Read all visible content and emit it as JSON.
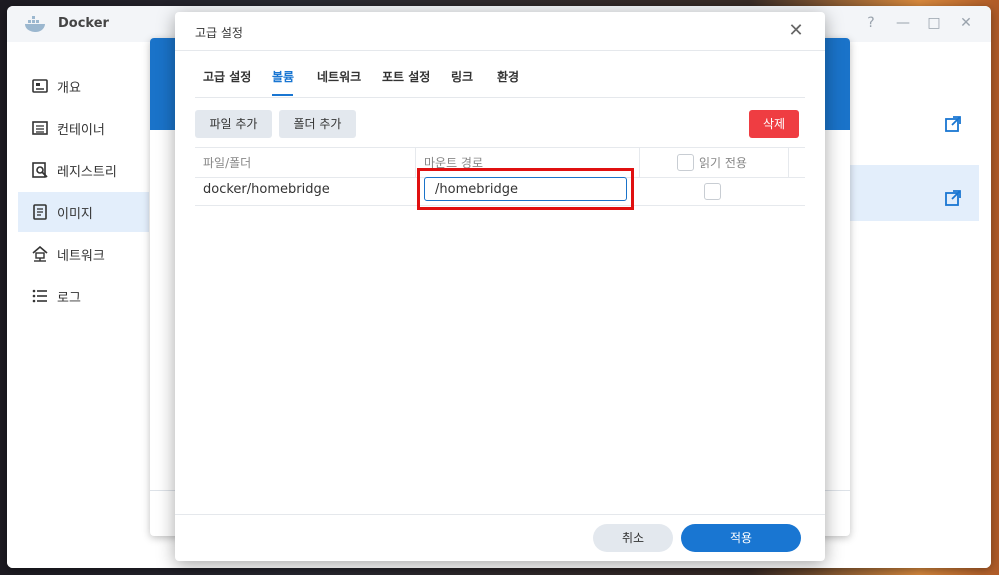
{
  "app": {
    "title": "Docker"
  },
  "window_controls": {
    "help": "?",
    "minimize": "—",
    "maximize": "□",
    "close": "✕"
  },
  "sidebar": {
    "items": [
      {
        "label": "개요",
        "icon": "overview-icon",
        "active": false
      },
      {
        "label": "컨테이너",
        "icon": "container-icon",
        "active": false
      },
      {
        "label": "레지스트리",
        "icon": "registry-icon",
        "active": false
      },
      {
        "label": "이미지",
        "icon": "image-icon",
        "active": true
      },
      {
        "label": "네트워크",
        "icon": "network-icon",
        "active": false
      },
      {
        "label": "로그",
        "icon": "log-icon",
        "active": false
      }
    ]
  },
  "dialog": {
    "title": "고급 설정",
    "close": "✕",
    "tabs": [
      {
        "label": "고급 설정",
        "active": false
      },
      {
        "label": "볼륨",
        "active": true
      },
      {
        "label": "네트워크",
        "active": false
      },
      {
        "label": "포트 설정",
        "active": false
      },
      {
        "label": "링크",
        "active": false
      },
      {
        "label": "환경",
        "active": false
      }
    ],
    "toolbar": {
      "add_file": "파일 추가",
      "add_folder": "폴더 추가",
      "delete": "삭제"
    },
    "table": {
      "headers": {
        "file_folder": "파일/폴더",
        "mount_path": "마운트 경로",
        "read_only": "읽기 전용"
      },
      "rows": [
        {
          "file_folder": "docker/homebridge",
          "mount_path": "/homebridge",
          "read_only": false
        }
      ]
    },
    "footer": {
      "cancel": "취소",
      "apply": "적용"
    }
  },
  "colors": {
    "accent": "#1976d2",
    "danger": "#ef3d42",
    "highlight": "#e01010"
  }
}
